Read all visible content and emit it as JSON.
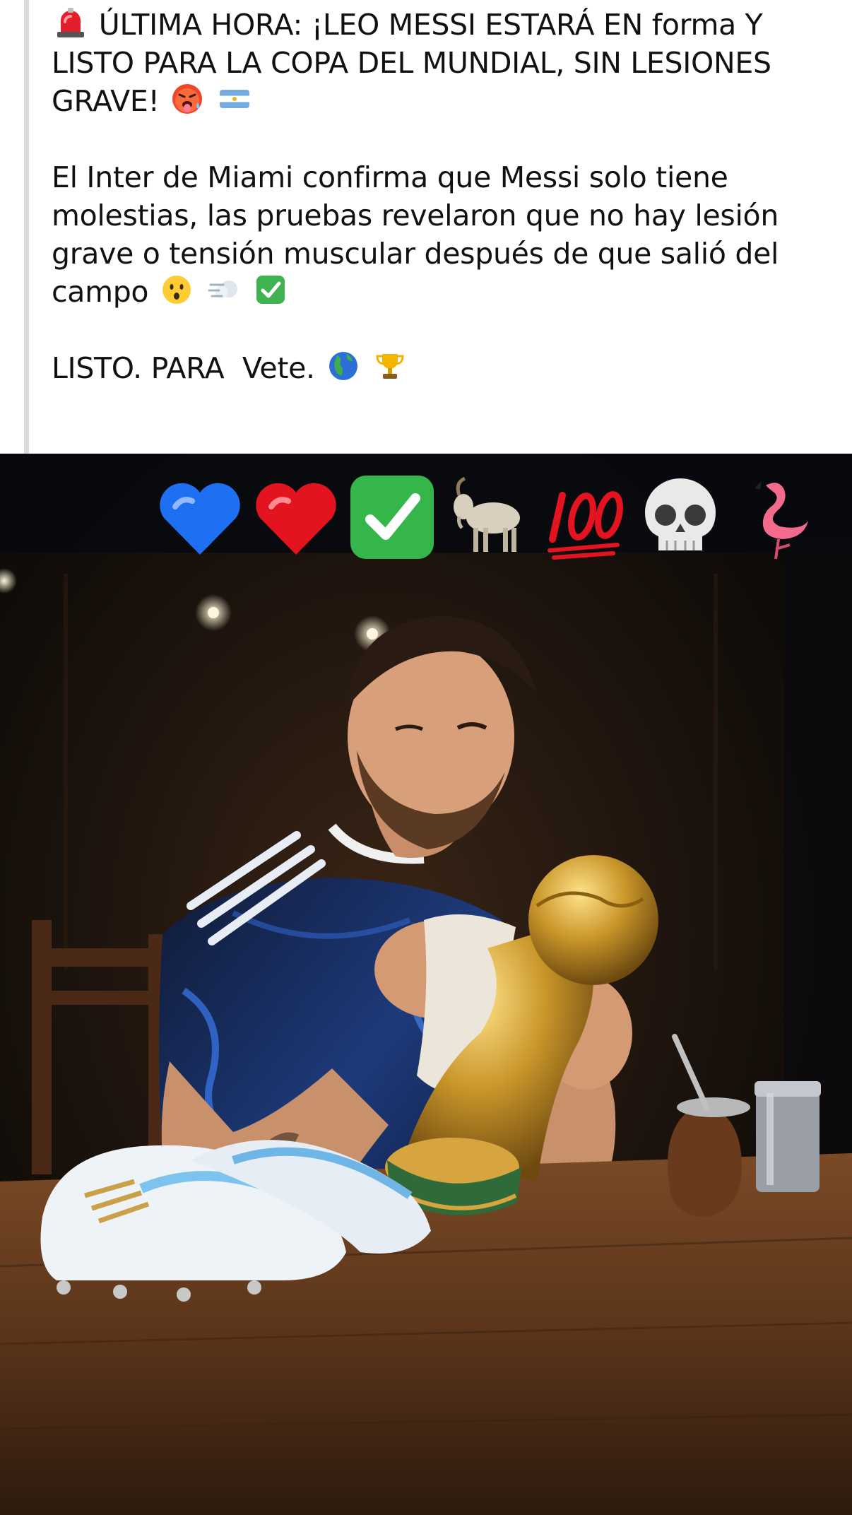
{
  "post": {
    "headline_line1": "ÚLTIMA HORA: ¡LEO MESSI ESTARÁ EN forma Y",
    "headline_line2": "LISTO PARA LA COPA DEL MUNDIAL, SIN LESIONES",
    "headline_line3": "GRAVE!",
    "body_line1": "El Inter de Miami confirma que Messi solo tiene",
    "body_line2": "molestias, las pruebas revelaron que no hay lesión",
    "body_line3": "grave o tensión muscular después de que salió del",
    "body_line4": "campo",
    "closing": "LISTO. PARA  Vete.",
    "icons": {
      "headline_prefix": "siren-icon",
      "headline_suffix": [
        "hot-face-icon",
        "argentina-flag-icon"
      ],
      "body_suffix": [
        "surprised-face-icon",
        "dash-icon",
        "check-mark-icon"
      ],
      "closing_suffix": [
        "globe-americas-icon",
        "trophy-icon"
      ]
    }
  },
  "photo": {
    "emoji_row": [
      "blue-heart-icon",
      "red-heart-icon",
      "check-mark-button-icon",
      "goat-icon",
      "hundred-points-icon",
      "skull-icon",
      "flamingo-icon"
    ],
    "colors": {
      "background": "#0b0a09",
      "table": "#6b3f1f",
      "jersey": "#1a2a55",
      "trophy": "#c9962a"
    }
  }
}
